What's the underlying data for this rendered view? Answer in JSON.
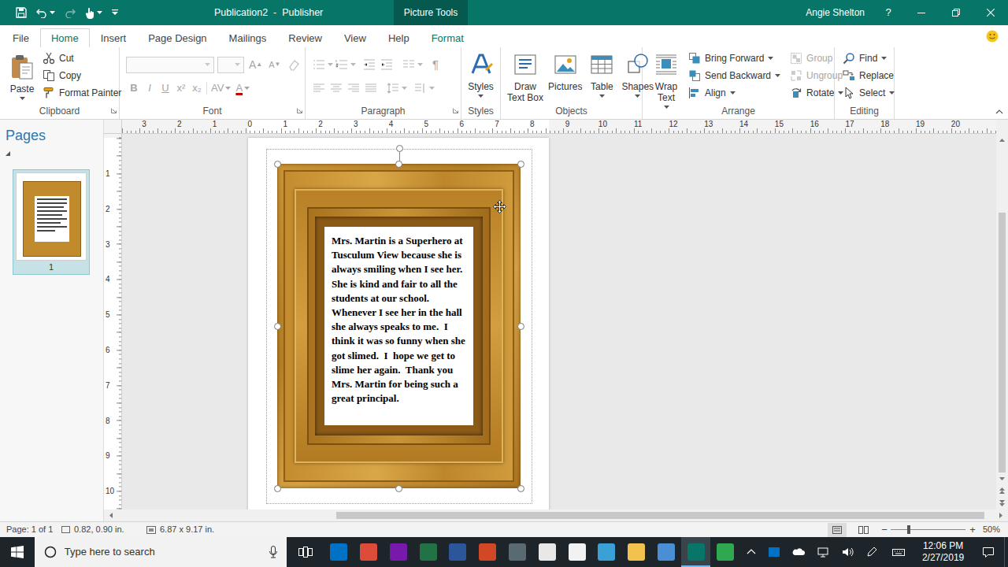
{
  "window": {
    "title": "Publication2  -  Publisher",
    "context_tab": "Picture Tools",
    "user": "Angie Shelton",
    "help": "?"
  },
  "tabs": [
    {
      "label": "File",
      "selected": false,
      "contextual": false
    },
    {
      "label": "Home",
      "selected": true,
      "contextual": false
    },
    {
      "label": "Insert",
      "selected": false,
      "contextual": false
    },
    {
      "label": "Page Design",
      "selected": false,
      "contextual": false
    },
    {
      "label": "Mailings",
      "selected": false,
      "contextual": false
    },
    {
      "label": "Review",
      "selected": false,
      "contextual": false
    },
    {
      "label": "View",
      "selected": false,
      "contextual": false
    },
    {
      "label": "Help",
      "selected": false,
      "contextual": false
    },
    {
      "label": "Format",
      "selected": false,
      "contextual": true
    }
  ],
  "ribbon": {
    "clipboard": {
      "label": "Clipboard",
      "paste": "Paste",
      "cut": "Cut",
      "copy": "Copy",
      "format_painter": "Format Painter"
    },
    "font": {
      "label": "Font",
      "disabled": true,
      "size_glyphs": [
        "A",
        "A"
      ],
      "format_glyphs": [
        "B",
        "I",
        "U",
        "x²",
        "x₂",
        "AV",
        "A"
      ]
    },
    "paragraph": {
      "label": "Paragraph",
      "disabled": true,
      "pilcrow": "¶"
    },
    "styles": {
      "label": "Styles",
      "button": "Styles"
    },
    "objects": {
      "label": "Objects",
      "buttons": [
        {
          "lines": [
            "Draw",
            "Text Box"
          ],
          "kind": "textbox"
        },
        {
          "lines": [
            "Pictures"
          ],
          "kind": "pictures"
        },
        {
          "lines": [
            "Table"
          ],
          "kind": "table"
        },
        {
          "lines": [
            "Shapes"
          ],
          "kind": "shapes"
        }
      ]
    },
    "arrange": {
      "label": "Arrange",
      "wrap_text": [
        "Wrap",
        "Text"
      ],
      "items": [
        {
          "label": "Bring Forward",
          "kind": "bring",
          "disabled": false
        },
        {
          "label": "Send Backward",
          "kind": "send",
          "disabled": false
        },
        {
          "label": "Align",
          "kind": "align",
          "disabled": false
        },
        {
          "label": "Group",
          "kind": "group",
          "disabled": true
        },
        {
          "label": "Ungroup",
          "kind": "ungroup",
          "disabled": true
        },
        {
          "label": "Rotate",
          "kind": "rotate",
          "disabled": false
        }
      ]
    },
    "editing": {
      "label": "Editing",
      "items": [
        {
          "label": "Find",
          "kind": "find"
        },
        {
          "label": "Replace",
          "kind": "replace"
        },
        {
          "label": "Select",
          "kind": "select"
        }
      ]
    }
  },
  "pages_pane": {
    "title": "Pages",
    "pages": [
      {
        "number": "1",
        "selected": true
      }
    ]
  },
  "rulers": {
    "horizontal": [
      "3",
      "2",
      "1",
      "0",
      "1",
      "2",
      "3",
      "4",
      "5",
      "6",
      "7",
      "8",
      "9",
      "10",
      "11",
      "12",
      "13",
      "14",
      "15",
      "16",
      "17",
      "18",
      "19",
      "20"
    ],
    "vertical": [
      "1",
      "2",
      "3",
      "4",
      "5",
      "6",
      "7",
      "8",
      "9",
      "10"
    ]
  },
  "document": {
    "text": "Mrs. Martin is a Superhero at Tusculum View because she is always smiling when I see her.  She is kind and fair to all the students at our school.  Whenever I see her in the hall she always speaks to me.  I think it was so funny when she got slimed.  I  hope we get to slime her again.  Thank you Mrs. Martin for being such a great principal."
  },
  "status_bar": {
    "page": "Page: 1 of 1",
    "position": "0.82, 0.90 in.",
    "size": "6.87 x 9.17 in.",
    "zoom_out": "−",
    "zoom_in": "+",
    "zoom": "50%",
    "zoom_level": 0.24
  },
  "taskbar": {
    "search_placeholder": "Type here to search",
    "time": "12:06 PM",
    "date": "2/27/2019",
    "apps": [
      {
        "color": "#0072c6",
        "active": false
      },
      {
        "color": "#dd4b39",
        "active": false
      },
      {
        "color": "#7719aa",
        "active": false
      },
      {
        "color": "#217346",
        "active": false
      },
      {
        "color": "#2b579a",
        "active": false
      },
      {
        "color": "#d24726",
        "active": false
      },
      {
        "color": "#5a6a73",
        "active": false
      },
      {
        "color": "#e8e8e8",
        "active": false
      },
      {
        "color": "#f2f2f2",
        "active": false
      },
      {
        "color": "#3aa0d8",
        "active": false
      },
      {
        "color": "#f2c14e",
        "active": false
      },
      {
        "color": "#4a8fd4",
        "active": false
      },
      {
        "color": "#077568",
        "active": true
      },
      {
        "color": "#2fa84f",
        "active": false
      }
    ]
  }
}
